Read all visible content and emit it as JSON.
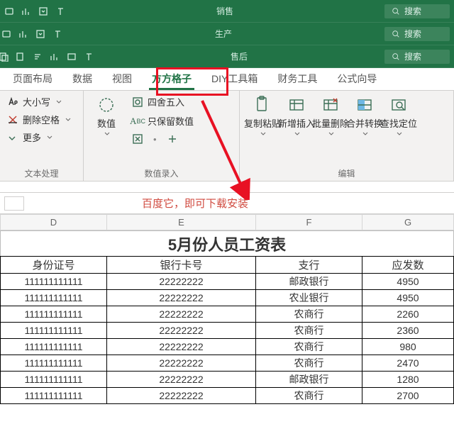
{
  "titlebars": [
    {
      "center": "销售",
      "search": "搜索"
    },
    {
      "center": "生产",
      "search": "搜索"
    },
    {
      "center": "售后",
      "search": "搜索"
    }
  ],
  "tabs": [
    "页面布局",
    "数据",
    "视图",
    "方方格子",
    "DIY工具箱",
    "财务工具",
    "公式向导"
  ],
  "active_tab_index": 3,
  "ribbon": {
    "text_proc": {
      "item1": "大小写",
      "item2": "删除空格",
      "item3": "更多",
      "title": "文本处理"
    },
    "numeric": {
      "big": "数值",
      "row1": "四舍五入",
      "row2": "只保留数值",
      "title": "数值录入"
    },
    "edit": {
      "b1": "复制粘贴",
      "b2": "新增插入",
      "b3": "批量删除",
      "b4": "合并转换",
      "b5": "查找定位",
      "title": "编辑"
    }
  },
  "fx_note": "百度它，即可下载安装",
  "columns": [
    "D",
    "E",
    "F",
    "G"
  ],
  "sheet": {
    "title": "5月份人员工资表",
    "headers": [
      "身份证号",
      "银行卡号",
      "支行",
      "应发数"
    ],
    "rows": [
      [
        "111111111111",
        "22222222",
        "邮政银行",
        "4950"
      ],
      [
        "111111111111",
        "22222222",
        "农业银行",
        "4950"
      ],
      [
        "111111111111",
        "22222222",
        "农商行",
        "2260"
      ],
      [
        "111111111111",
        "22222222",
        "农商行",
        "2360"
      ],
      [
        "111111111111",
        "22222222",
        "农商行",
        "980"
      ],
      [
        "111111111111",
        "22222222",
        "农商行",
        "2470"
      ],
      [
        "111111111111",
        "22222222",
        "邮政银行",
        "1280"
      ],
      [
        "111111111111",
        "22222222",
        "农商行",
        "2700"
      ]
    ]
  }
}
